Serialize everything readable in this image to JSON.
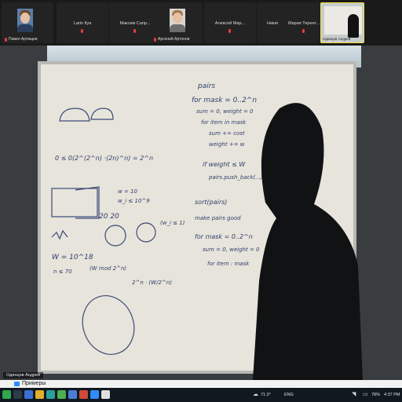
{
  "participants": [
    {
      "name": "Павел Артищев",
      "muted": true
    },
    {
      "name": "Larin Ilya",
      "muted": true
    },
    {
      "name": "Максим Сапр...",
      "muted": true
    },
    {
      "name": "Арсений Артонов",
      "muted": true
    },
    {
      "name": "Алексей Мар...",
      "muted": true
    },
    {
      "name": "Никита Баран...",
      "muted": true
    },
    {
      "name": "Мария Терент...",
      "muted": true
    },
    {
      "name": "Одинцов Андрей",
      "muted": false,
      "active": true
    }
  ],
  "active_speaker_label": "Одинцов Андрей",
  "window_title": "Примеры",
  "board": {
    "left": {
      "l1": "0  ≤  0(2^(2^n) ·(2n)^n) = 2^n",
      "l2": "w = 10",
      "l3": "w_i ≤ 10^9",
      "l4": "W = 10^18",
      "l5": "n ≤ 70",
      "l6": "(W mod 2^n)",
      "l7": "2^n · (W/2^n)",
      "l8": "20   20",
      "l9": "(w_i ≤ 1)"
    },
    "right": {
      "r1": "pairs",
      "r2": "for mask = 0..2^n",
      "r3": "sum = 0, weight = 0",
      "r4": "for item in mask",
      "r5": "sum += cost",
      "r6": "weight += w",
      "r7": "if weight ≤ W",
      "r8": "pairs.push_back(...)",
      "r9": "sort(pairs)",
      "r10": "make pairs good",
      "r11": "for mask = 0..2^n",
      "r12": "sum = 0, weight = 0",
      "r13": "for item : mask"
    }
  },
  "taskbar": {
    "temperature": "71.0°",
    "battery": "78%",
    "time": "4:37 PM",
    "language": "ENG"
  },
  "colors": {
    "accent": "#f4e23b",
    "muted_mic": "#e2403a",
    "board": "#e7e4db"
  }
}
